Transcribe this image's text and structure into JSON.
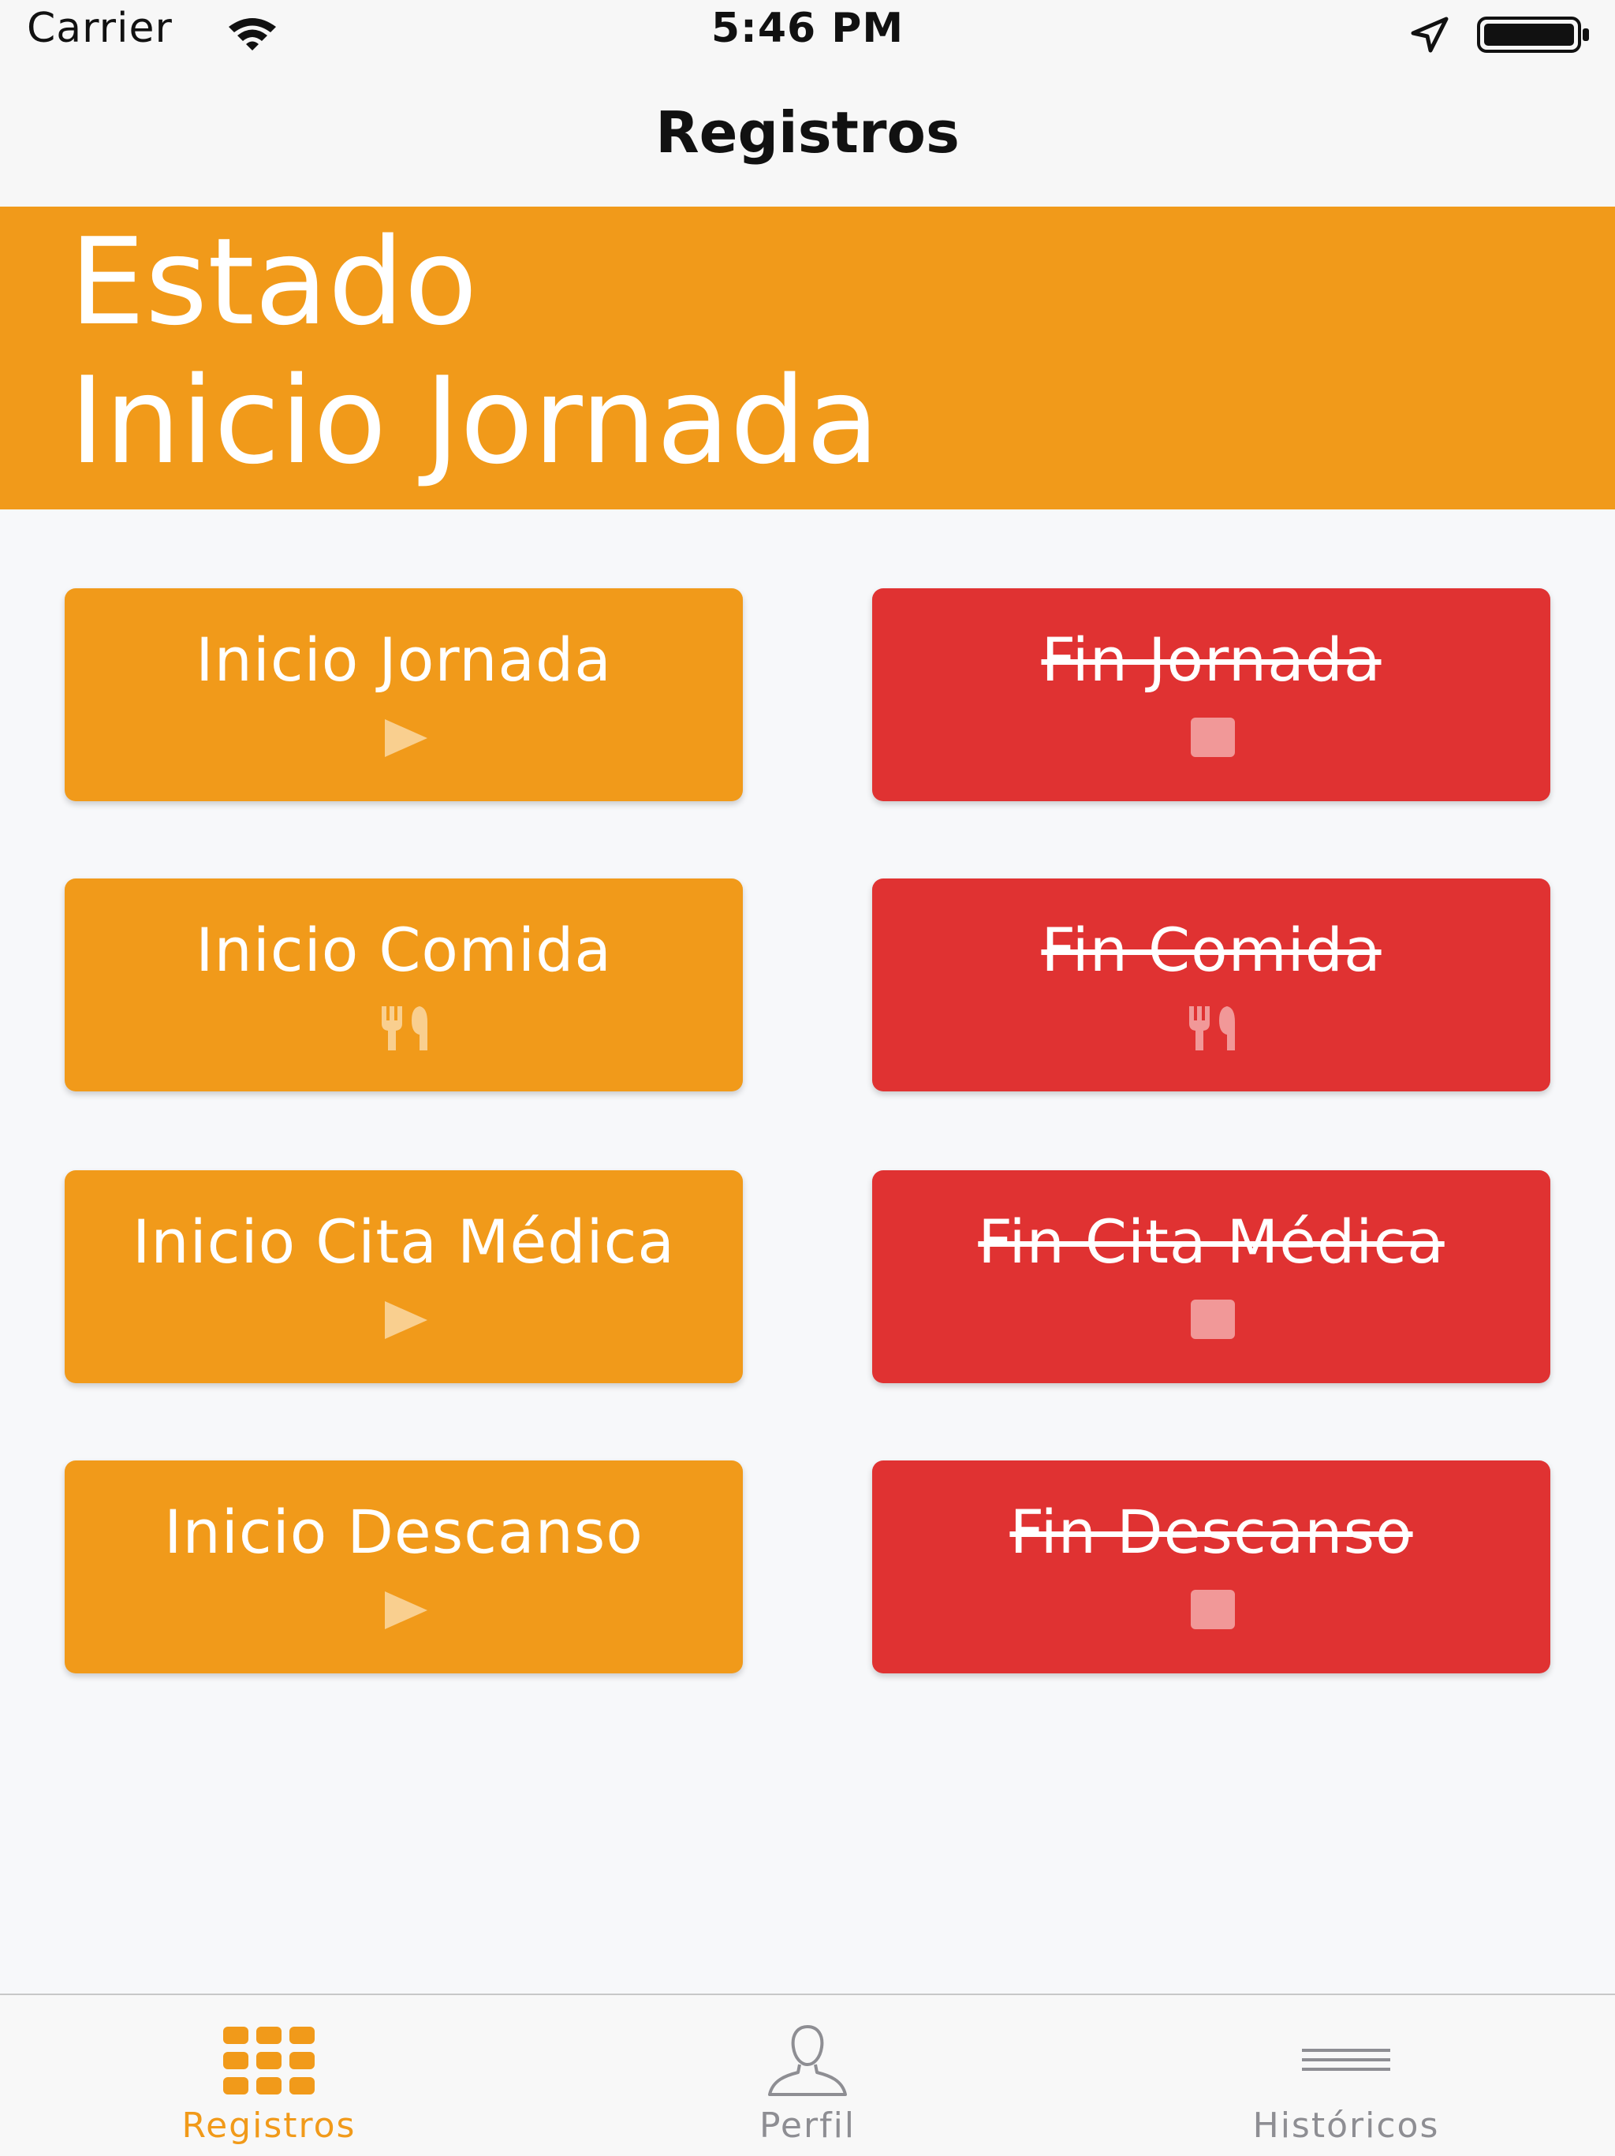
{
  "status_bar": {
    "carrier": "Carrier",
    "time": "5:46 PM"
  },
  "nav": {
    "title": "Registros"
  },
  "state": {
    "label": "Estado",
    "value": "Inicio Jornada"
  },
  "colors": {
    "accent": "#f19a1a",
    "danger": "#e03232",
    "background": "#f7f8fa",
    "inactive_tab": "#8e8e93"
  },
  "buttons": [
    {
      "label": "Inicio Jornada",
      "icon": "play-icon",
      "variant": "orange",
      "enabled": true
    },
    {
      "label": "Fin Jornada",
      "icon": "stop-icon",
      "variant": "red",
      "enabled": false
    },
    {
      "label": "Inicio Comida",
      "icon": "cutlery-icon",
      "variant": "orange",
      "enabled": true
    },
    {
      "label": "Fin Comida",
      "icon": "cutlery-icon",
      "variant": "red",
      "enabled": false
    },
    {
      "label": "Inicio Cita Médica",
      "icon": "play-icon",
      "variant": "orange",
      "enabled": true
    },
    {
      "label": "Fin Cita Médica",
      "icon": "stop-icon",
      "variant": "red",
      "enabled": false
    },
    {
      "label": "Inicio Descanso",
      "icon": "play-icon",
      "variant": "orange",
      "enabled": true
    },
    {
      "label": "Fin Descanso",
      "icon": "stop-icon",
      "variant": "red",
      "enabled": false
    }
  ],
  "tabs": [
    {
      "label": "Registros",
      "icon": "grid-icon",
      "active": true
    },
    {
      "label": "Perfil",
      "icon": "person-icon",
      "active": false
    },
    {
      "label": "Históricos",
      "icon": "list-icon",
      "active": false
    }
  ]
}
